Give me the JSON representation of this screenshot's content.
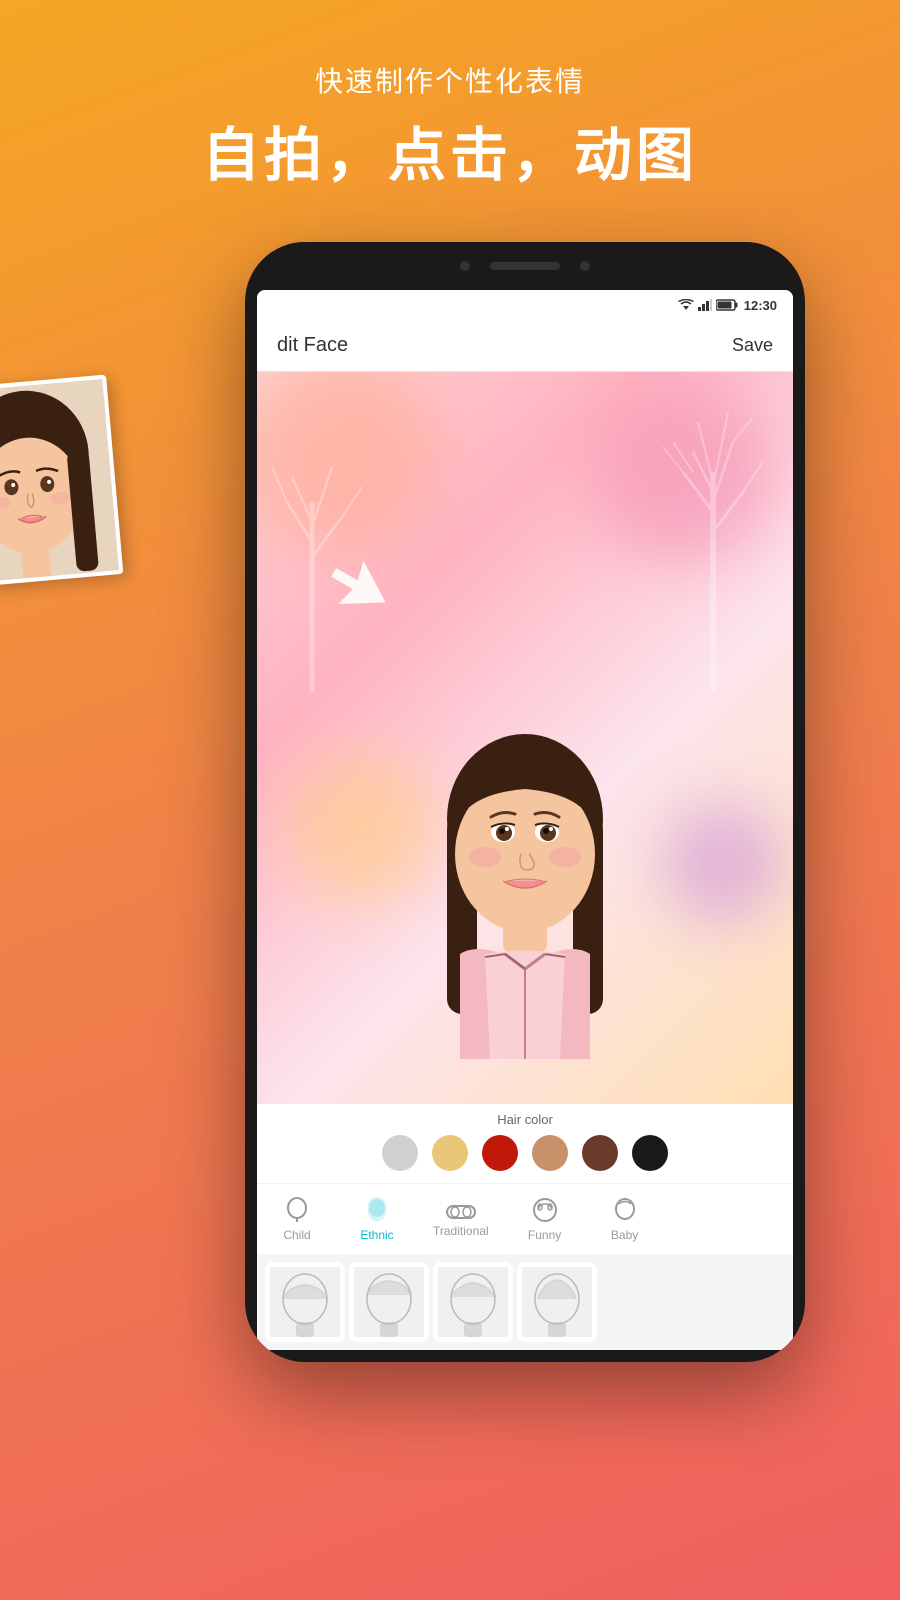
{
  "page": {
    "background_gradient": "linear-gradient(160deg, #f5a623 0%, #f0804a 50%, #f06060 100%)"
  },
  "top_text": {
    "subtitle": "快速制作个性化表情",
    "title": "自拍，点击，动图"
  },
  "status_bar": {
    "time": "12:30",
    "wifi": "▼",
    "signal": "▲",
    "battery": "🔋"
  },
  "toolbar": {
    "title": "dit Face",
    "save_label": "Save"
  },
  "hair_color": {
    "label": "Hair color",
    "swatches": [
      {
        "color": "#d0d0d0",
        "name": "silver",
        "active": false
      },
      {
        "color": "#e8c878",
        "name": "blonde",
        "active": false
      },
      {
        "color": "#c0190a",
        "name": "red",
        "active": false
      },
      {
        "color": "#c8916a",
        "name": "light-brown",
        "active": false
      },
      {
        "color": "#6b3a2a",
        "name": "brown",
        "active": false
      },
      {
        "color": "#1a1a1a",
        "name": "black",
        "active": false
      }
    ]
  },
  "categories": [
    {
      "id": "child",
      "label": "Child",
      "icon": "face",
      "active": false
    },
    {
      "id": "ethnic",
      "label": "Ethnic",
      "icon": "head",
      "active": true
    },
    {
      "id": "traditional",
      "label": "Traditional",
      "icon": "glasses",
      "active": false
    },
    {
      "id": "funny",
      "label": "Funny",
      "icon": "eye",
      "active": false
    },
    {
      "id": "baby",
      "label": "Baby",
      "icon": "face2",
      "active": false
    }
  ],
  "style_thumbs": [
    {
      "id": 1,
      "label": "style-1"
    },
    {
      "id": 2,
      "label": "style-2"
    },
    {
      "id": 3,
      "label": "style-3"
    },
    {
      "id": 4,
      "label": "style-4"
    }
  ]
}
